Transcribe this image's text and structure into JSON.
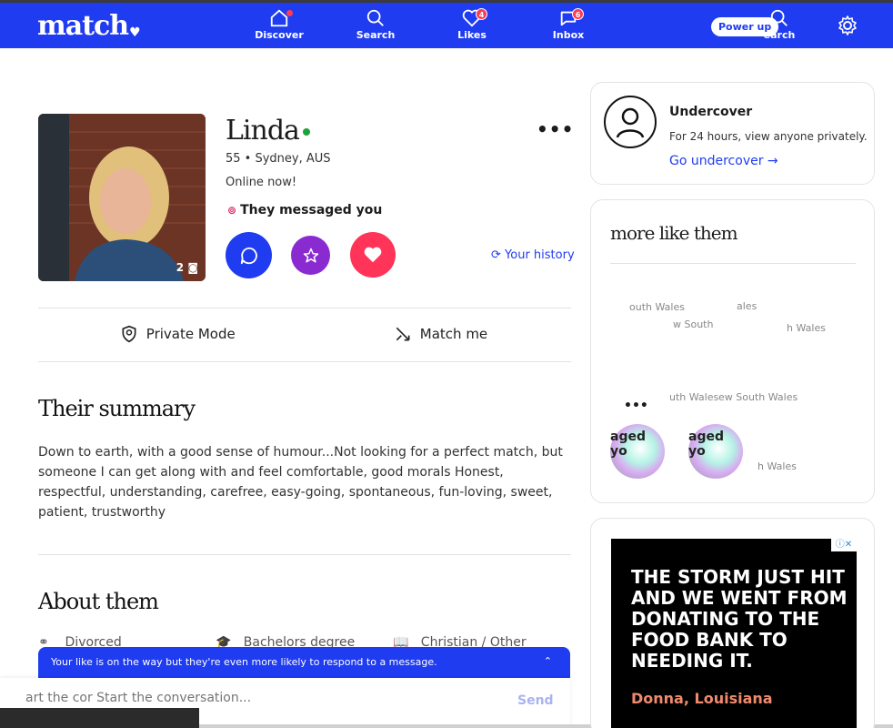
{
  "nav": {
    "logo": "match",
    "discover": "Discover",
    "search": "Search",
    "likes": "Likes",
    "likes_badge": "4",
    "inbox": "Inbox",
    "inbox_badge": "6",
    "power_up": "Power up",
    "search2": "earch"
  },
  "profile": {
    "name": "Linda",
    "meta": "55 • Sydney, AUS",
    "status": "Online now!",
    "messaged": "They messaged you",
    "photo_count": "2",
    "history": "Your history",
    "private_mode": "Private Mode",
    "match_me": "Match me"
  },
  "summary": {
    "heading": "Their summary",
    "text": "Down to earth, with a good sense of humour...Not looking for a perfect match, but someone I can get along with and feel comfortable, good morals Honest, respectful, understanding, carefree, easy-going, spontaneous, fun-loving, sweet, patient, trustworthy"
  },
  "about": {
    "heading": "About them",
    "items": [
      "Divorced",
      "Bachelors degree",
      "Christian / Other"
    ]
  },
  "composer": {
    "banner": "Your like is on the way but they're even more likely to respond to a message.",
    "placeholder": "art the cor Start the conversation...",
    "send": "Send"
  },
  "undercover": {
    "title": "Undercover",
    "subtitle": "For 24 hours, view anyone privately.",
    "link": "Go undercover →"
  },
  "more_like": {
    "title": "more like them",
    "blurred": [
      "outh Wales",
      "ales",
      "w South",
      "h Wales",
      "uth Wales",
      "ew South Wales",
      "h Wales"
    ],
    "avatar_text": "aged yo"
  },
  "ad": {
    "headline": "THE STORM JUST HIT AND WE WENT FROM DONATING TO THE FOOD BANK TO NEEDING IT.",
    "location": "Donna, Louisiana",
    "badge": "ⓘ✕"
  }
}
